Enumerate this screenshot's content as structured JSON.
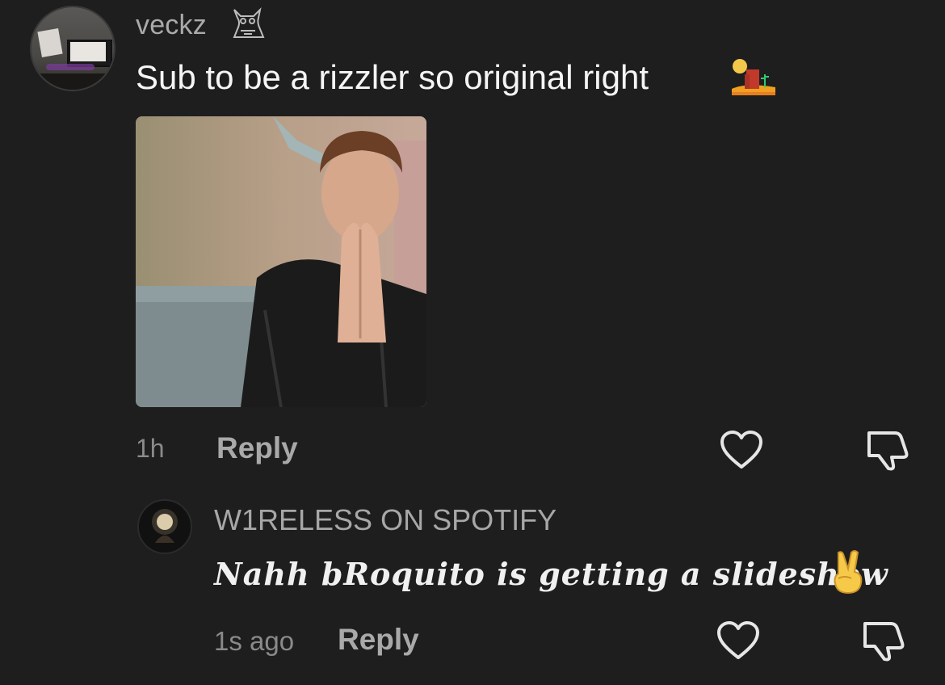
{
  "comments": [
    {
      "username": "veckz",
      "username_badge_icon": "owl-icon",
      "text": "Sub to be a rizzler so original right",
      "emoji": "desert-emoji",
      "attachment": "photo-attachment",
      "time": "1h",
      "reply_label": "Reply"
    },
    {
      "username": "W1RELESS ON SPOTIFY",
      "text": "Nahh bRoquito is getting a slideshow",
      "emoji": "victory-hand-emoji",
      "time": "1s ago",
      "reply_label": "Reply"
    }
  ],
  "icons": {
    "like": "heart-icon",
    "dislike": "thumbs-down-icon"
  },
  "colors": {
    "background": "#1e1e1e",
    "username": "#aaaaaa",
    "comment_text": "#f5f5f5",
    "meta_text": "#8a8a8a"
  }
}
